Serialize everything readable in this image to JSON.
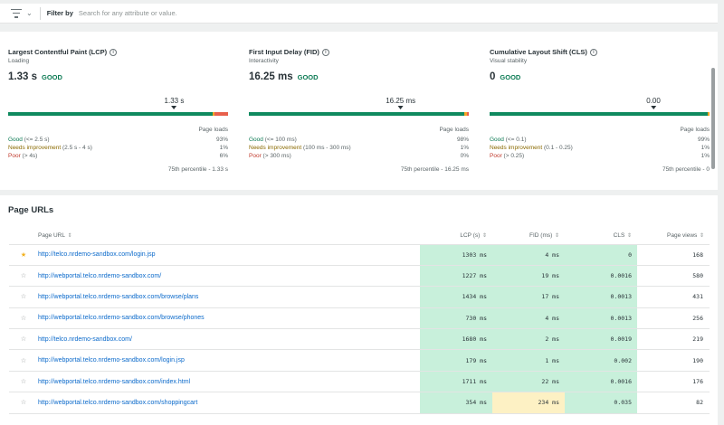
{
  "filter": {
    "label": "Filter by",
    "placeholder": "Search for any attribute or value."
  },
  "metrics": [
    {
      "title": "Largest Contentful Paint (LCP)",
      "subtitle": "Loading",
      "value": "1.33 s",
      "status": "GOOD",
      "marker": "1.33 s",
      "marker_position": 0.755,
      "distribution": [
        0.93,
        0.01,
        0.06
      ],
      "page_loads_label": "Page loads",
      "rows": [
        {
          "label": "Good",
          "range": "(<= 2.5 s)",
          "pct": "93%"
        },
        {
          "label": "Needs improvement",
          "range": "(2.5 s - 4 s)",
          "pct": "1%"
        },
        {
          "label": "Poor",
          "range": "(> 4s)",
          "pct": "6%"
        }
      ],
      "percentile": "75th percentile - 1.33 s"
    },
    {
      "title": "First Input Delay (FID)",
      "subtitle": "Interactivity",
      "value": "16.25 ms",
      "status": "GOOD",
      "marker": "16.25 ms",
      "marker_position": 0.69,
      "distribution": [
        0.98,
        0.01,
        0.01
      ],
      "page_loads_label": "Page loads",
      "rows": [
        {
          "label": "Good",
          "range": "(<= 100 ms)",
          "pct": "98%"
        },
        {
          "label": "Needs improvement",
          "range": "(100 ms - 300 ms)",
          "pct": "1%"
        },
        {
          "label": "Poor",
          "range": "(> 300 ms)",
          "pct": "0%"
        }
      ],
      "percentile": "75th percentile - 16.25 ms"
    },
    {
      "title": "Cumulative Layout Shift (CLS)",
      "subtitle": "Visual stability",
      "value": "0",
      "status": "GOOD",
      "marker": "0.00",
      "marker_position": 0.745,
      "distribution": [
        0.99,
        0.01,
        0.0
      ],
      "page_loads_label": "Page loads",
      "rows": [
        {
          "label": "Good",
          "range": "(<= 0.1)",
          "pct": "99%"
        },
        {
          "label": "Needs improvement",
          "range": "(0.1 - 0.25)",
          "pct": "1%"
        },
        {
          "label": "Poor",
          "range": "(> 0.25)",
          "pct": "1%"
        }
      ],
      "percentile": "75th percentile - 0"
    }
  ],
  "colors": {
    "good": "#0f8a5f",
    "needs_improvement": "#f5a623",
    "poor": "#e8604c",
    "good_cell": "#c8f0db",
    "warn_cell": "#fdf1c4"
  },
  "urls": {
    "title": "Page URLs",
    "columns": {
      "url": "Page URL",
      "lcp": "LCP (s)",
      "fid": "FID (ms)",
      "cls": "CLS",
      "views": "Page views"
    },
    "rows": [
      {
        "fav": true,
        "url": "http://telco.nrdemo-sandbox.com/login.jsp",
        "lcp": "1303 ms",
        "fid": "4 ms",
        "fid_warn": false,
        "cls": "0",
        "views": "168"
      },
      {
        "fav": false,
        "url": "http://webportal.telco.nrdemo-sandbox.com/",
        "lcp": "1227 ms",
        "fid": "19 ms",
        "fid_warn": false,
        "cls": "0.0016",
        "views": "580"
      },
      {
        "fav": false,
        "url": "http://webportal.telco.nrdemo-sandbox.com/browse/plans",
        "lcp": "1434 ms",
        "fid": "17 ms",
        "fid_warn": false,
        "cls": "0.0013",
        "views": "431"
      },
      {
        "fav": false,
        "url": "http://webportal.telco.nrdemo-sandbox.com/browse/phones",
        "lcp": "730 ms",
        "fid": "4 ms",
        "fid_warn": false,
        "cls": "0.0013",
        "views": "256"
      },
      {
        "fav": false,
        "url": "http://telco.nrdemo-sandbox.com/",
        "lcp": "1680 ms",
        "fid": "2 ms",
        "fid_warn": false,
        "cls": "0.0019",
        "views": "219"
      },
      {
        "fav": false,
        "url": "http://webportal.telco.nrdemo-sandbox.com/login.jsp",
        "lcp": "179 ms",
        "fid": "1 ms",
        "fid_warn": false,
        "cls": "0.002",
        "views": "190"
      },
      {
        "fav": false,
        "url": "http://webportal.telco.nrdemo-sandbox.com/index.html",
        "lcp": "1711 ms",
        "fid": "22 ms",
        "fid_warn": false,
        "cls": "0.0016",
        "views": "176"
      },
      {
        "fav": false,
        "url": "http://webportal.telco.nrdemo-sandbox.com/shoppingcart",
        "lcp": "354 ms",
        "fid": "234 ms",
        "fid_warn": true,
        "cls": "0.035",
        "views": "82"
      }
    ]
  }
}
